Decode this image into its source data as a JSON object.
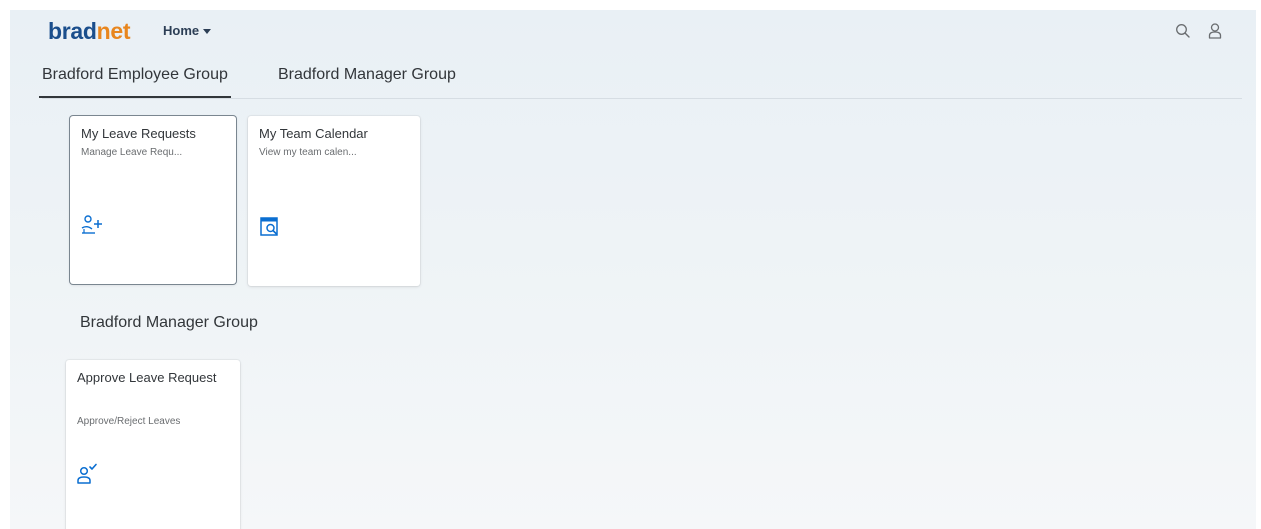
{
  "shell": {
    "logo_part1": "brad",
    "logo_part2": "net",
    "home_label": "Home",
    "icons": [
      "search-icon",
      "user-icon"
    ]
  },
  "tabs": [
    {
      "label": "Bradford Employee Group",
      "active": true
    },
    {
      "label": "Bradford Manager Group",
      "active": false
    }
  ],
  "groups": {
    "employee": {
      "tiles": [
        {
          "title": "My Leave Requests",
          "subtitle": "Manage Leave Requ...",
          "icon": "leave-request-icon"
        },
        {
          "title": "My Team Calendar",
          "subtitle": "View my team calen...",
          "icon": "calendar-search-icon"
        }
      ]
    },
    "manager": {
      "title": "Bradford Manager Group",
      "tiles": [
        {
          "title": "Approve Leave Request",
          "subtitle": "Approve/Reject Leaves",
          "icon": "user-approve-icon"
        }
      ]
    }
  },
  "colors": {
    "logo_blue": "#1a4e8c",
    "logo_orange": "#e8861e",
    "icon_blue": "#0a6ed1",
    "text": "#32363a"
  }
}
